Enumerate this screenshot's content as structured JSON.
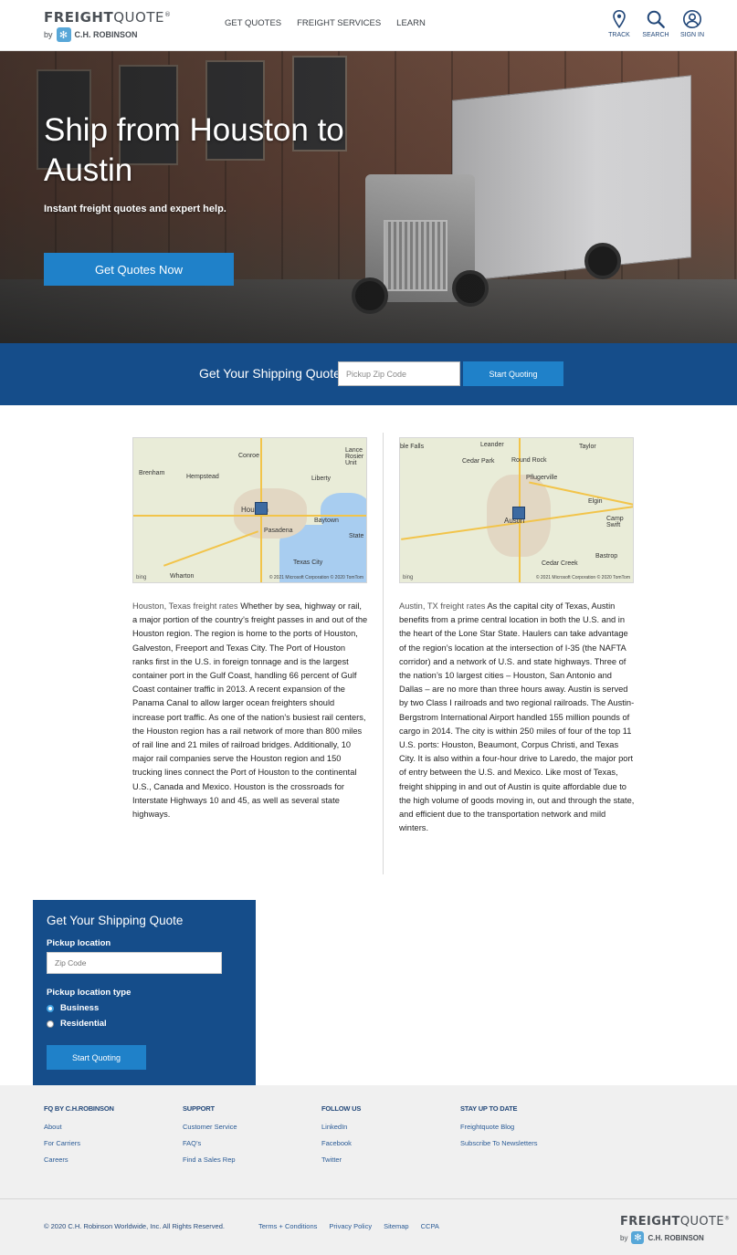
{
  "header": {
    "logo_word_1": "FREIGHT",
    "logo_word_2": "QUOTE",
    "logo_mark": "®",
    "logo_by": "by",
    "logo_company": "C.H. ROBINSON",
    "nav": [
      "GET QUOTES",
      "FREIGHT SERVICES",
      "LEARN"
    ],
    "icons": [
      {
        "label": "TRACK",
        "icon": "location-pin-icon"
      },
      {
        "label": "SEARCH",
        "icon": "search-icon"
      },
      {
        "label": "SIGN IN",
        "icon": "user-icon"
      }
    ]
  },
  "hero": {
    "title": "Ship from Houston to Austin",
    "tagline": "Instant freight quotes and expert help.",
    "cta": "Get Quotes Now"
  },
  "quote_bar": {
    "title": "Get Your Shipping Quote",
    "zip_placeholder": "Pickup Zip Code",
    "button": "Start Quoting"
  },
  "origin": {
    "map_cities": [
      "Conroe",
      "Lance Rosier Unit",
      "Brenham",
      "Hempstead",
      "Liberty",
      "Houston",
      "Baytown",
      "Pasadena",
      "Wharton",
      "Texas City",
      "State"
    ],
    "map_credit": "© 2021 Microsoft Corporation © 2020 TomTom",
    "map_brand": "bing",
    "lead": "Houston, Texas freight rates",
    "body": "Whether by sea, highway or rail, a major portion of the country’s freight passes in and out of the Houston region. The region is home to the ports of Houston, Galveston, Freeport and Texas City. The Port of Houston ranks first in the U.S. in foreign tonnage and is the largest container port in the Gulf Coast, handling 66 percent of Gulf Coast container traffic in 2013. A recent expansion of the Panama Canal to allow larger ocean freighters should increase port traffic. As one of the nation’s busiest rail centers, the Houston region has a rail network of more than 800 miles of rail line and 21 miles of railroad bridges. Additionally, 10 major rail companies serve the Houston region and 150 trucking lines connect the Port of Houston to the continental U.S., Canada and Mexico. Houston is the crossroads for Interstate Highways 10 and 45, as well as several state highways."
  },
  "destination": {
    "map_cities": [
      "ble Falls",
      "Leander",
      "Taylor",
      "Cedar Park",
      "Round Rock",
      "Pflugerville",
      "Elgin",
      "Austin",
      "Camp Swift",
      "Cedar Creek",
      "Bastrop"
    ],
    "map_credit": "© 2021 Microsoft Corporation © 2020 TomTom",
    "map_brand": "bing",
    "lead": "Austin, TX freight rates",
    "body": "As the capital city of Texas, Austin benefits from a prime central location in both the U.S. and in the heart of the Lone Star State. Haulers can take advantage of the region’s location at the intersection of I-35 (the NAFTA corridor) and a network of U.S. and state highways. Three of the nation’s 10 largest cities – Houston, San Antonio and Dallas – are no more than three hours away. Austin is served by two Class I railroads and two regional railroads. The Austin-Bergstrom International Airport handled 155 million pounds of cargo in 2014. The city is within 250 miles of four of the top 11 U.S. ports: Houston, Beaumont, Corpus Christi, and Texas City. It is also within a four-hour drive to Laredo, the major port of entry between the U.S. and Mexico. Like most of Texas, freight shipping in and out of Austin is quite affordable due to the high volume of goods moving in, out and through the state, and efficient due to the transportation network and mild winters."
  },
  "quote_form": {
    "title": "Get Your Shipping Quote",
    "pickup_label": "Pickup location",
    "zip_placeholder": "Zip Code",
    "type_label": "Pickup location type",
    "options": [
      "Business",
      "Residential"
    ],
    "selected": "Business",
    "button": "Start Quoting"
  },
  "footer": {
    "columns": [
      {
        "heading": "FQ BY C.H.ROBINSON",
        "links": [
          "About",
          "For Carriers",
          "Careers"
        ]
      },
      {
        "heading": "SUPPORT",
        "links": [
          "Customer Service",
          "FAQ’s",
          "Find a Sales Rep"
        ]
      },
      {
        "heading": "FOLLOW US",
        "links": [
          "LinkedIn",
          "Facebook",
          "Twitter"
        ]
      },
      {
        "heading": "STAY UP TO DATE",
        "links": [
          "Freightquote Blog",
          "Subscribe To Newsletters"
        ]
      }
    ],
    "copyright": "© 2020 C.H. Robinson Worldwide, Inc. All Rights Reserved.",
    "legal_links": [
      "Terms + Conditions",
      "Privacy Policy",
      "Sitemap",
      "CCPA"
    ]
  },
  "colors": {
    "brand_blue": "#154d8a",
    "button_blue": "#1f81c9",
    "link_blue": "#2a5b96"
  }
}
